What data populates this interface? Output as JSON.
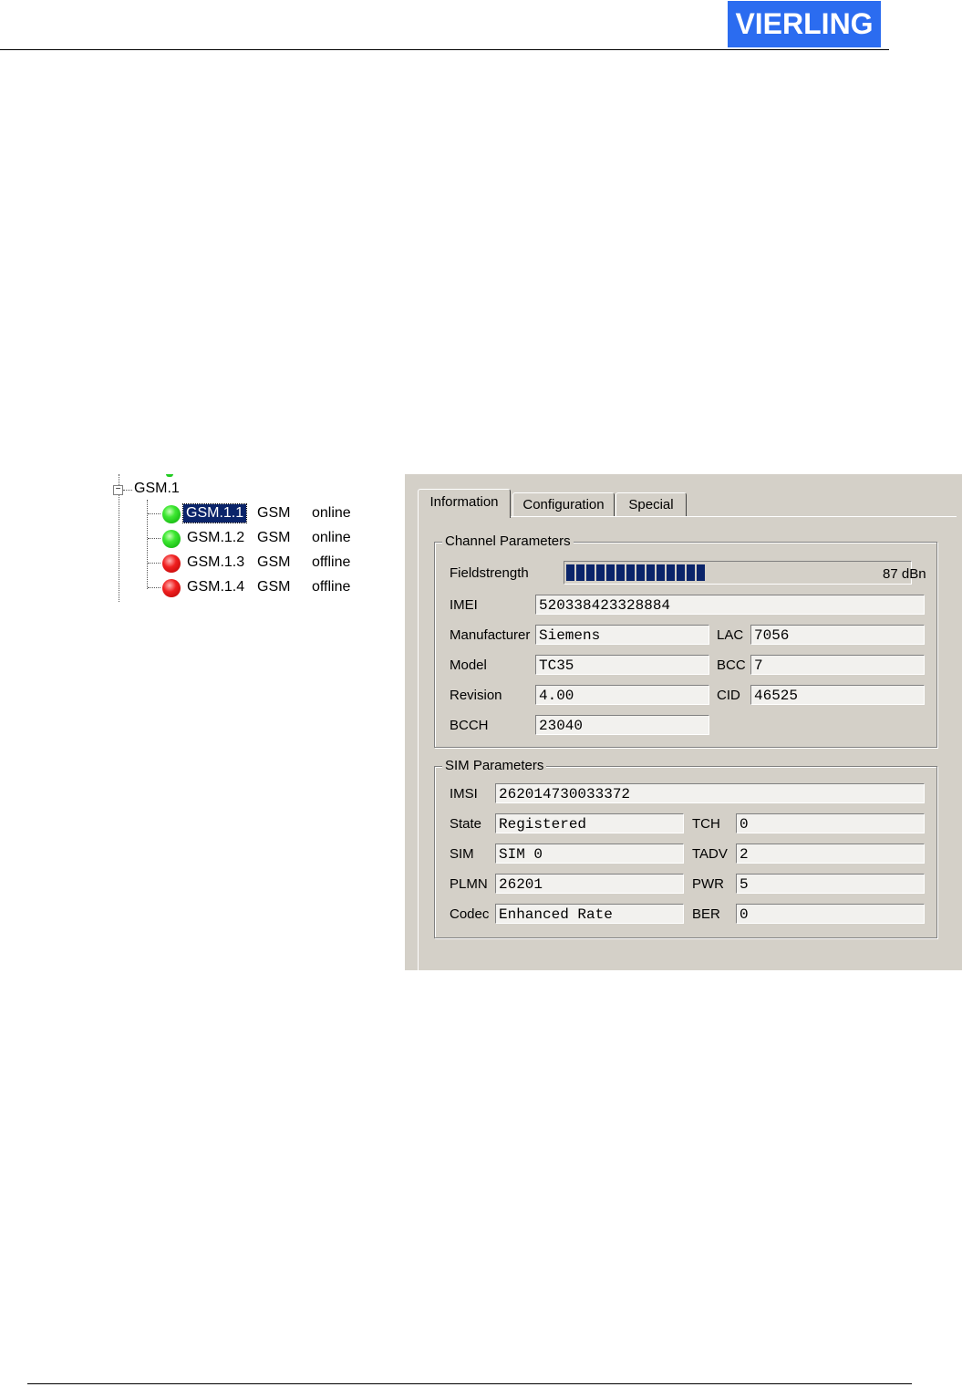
{
  "header": {
    "logo_text": "VIERLING"
  },
  "tree": {
    "root_label": "GSM.1",
    "expander_symbol": "−",
    "channels": [
      {
        "name": "GSM.1.1",
        "type": "GSM",
        "status": "online",
        "led": "green",
        "selected": true
      },
      {
        "name": "GSM.1.2",
        "type": "GSM",
        "status": "online",
        "led": "green",
        "selected": false
      },
      {
        "name": "GSM.1.3",
        "type": "GSM",
        "status": "offline",
        "led": "red",
        "selected": false
      },
      {
        "name": "GSM.1.4",
        "type": "GSM",
        "status": "offline",
        "led": "red",
        "selected": false
      }
    ]
  },
  "tabs": [
    {
      "label": "Information",
      "active": true
    },
    {
      "label": "Configuration",
      "active": false
    },
    {
      "label": "Special",
      "active": false
    }
  ],
  "channel_parameters": {
    "legend": "Channel Parameters",
    "fieldstrength": {
      "label": "Fieldstrength",
      "segments": 14,
      "value_text": "87 dBn"
    },
    "imei": {
      "label": "IMEI",
      "value": "520338423328884"
    },
    "manufacturer": {
      "label": "Manufacturer",
      "value": "Siemens"
    },
    "model": {
      "label": "Model",
      "value": "TC35"
    },
    "revision": {
      "label": "Revision",
      "value": "4.00"
    },
    "bcch": {
      "label": "BCCH",
      "value": "23040"
    },
    "lac": {
      "label": "LAC",
      "value": "7056"
    },
    "bcc": {
      "label": "BCC",
      "value": "7"
    },
    "cid": {
      "label": "CID",
      "value": "46525"
    }
  },
  "sim_parameters": {
    "legend": "SIM Parameters",
    "imsi": {
      "label": "IMSI",
      "value": "262014730033372"
    },
    "state": {
      "label": "State",
      "value": "Registered"
    },
    "sim": {
      "label": "SIM",
      "value": "SIM 0"
    },
    "plmn": {
      "label": "PLMN",
      "value": "26201"
    },
    "codec": {
      "label": "Codec",
      "value": "Enhanced Rate"
    },
    "tch": {
      "label": "TCH",
      "value": "0"
    },
    "tadv": {
      "label": "TADV",
      "value": "2"
    },
    "pwr": {
      "label": "PWR",
      "value": "5"
    },
    "ber": {
      "label": "BER",
      "value": "0"
    }
  },
  "colors": {
    "logo_bg": "#2b6cf0",
    "selection": "#0a246a",
    "panel_bg": "#d4d0c8",
    "led_online": "#22cc22",
    "led_offline": "#e01010"
  }
}
